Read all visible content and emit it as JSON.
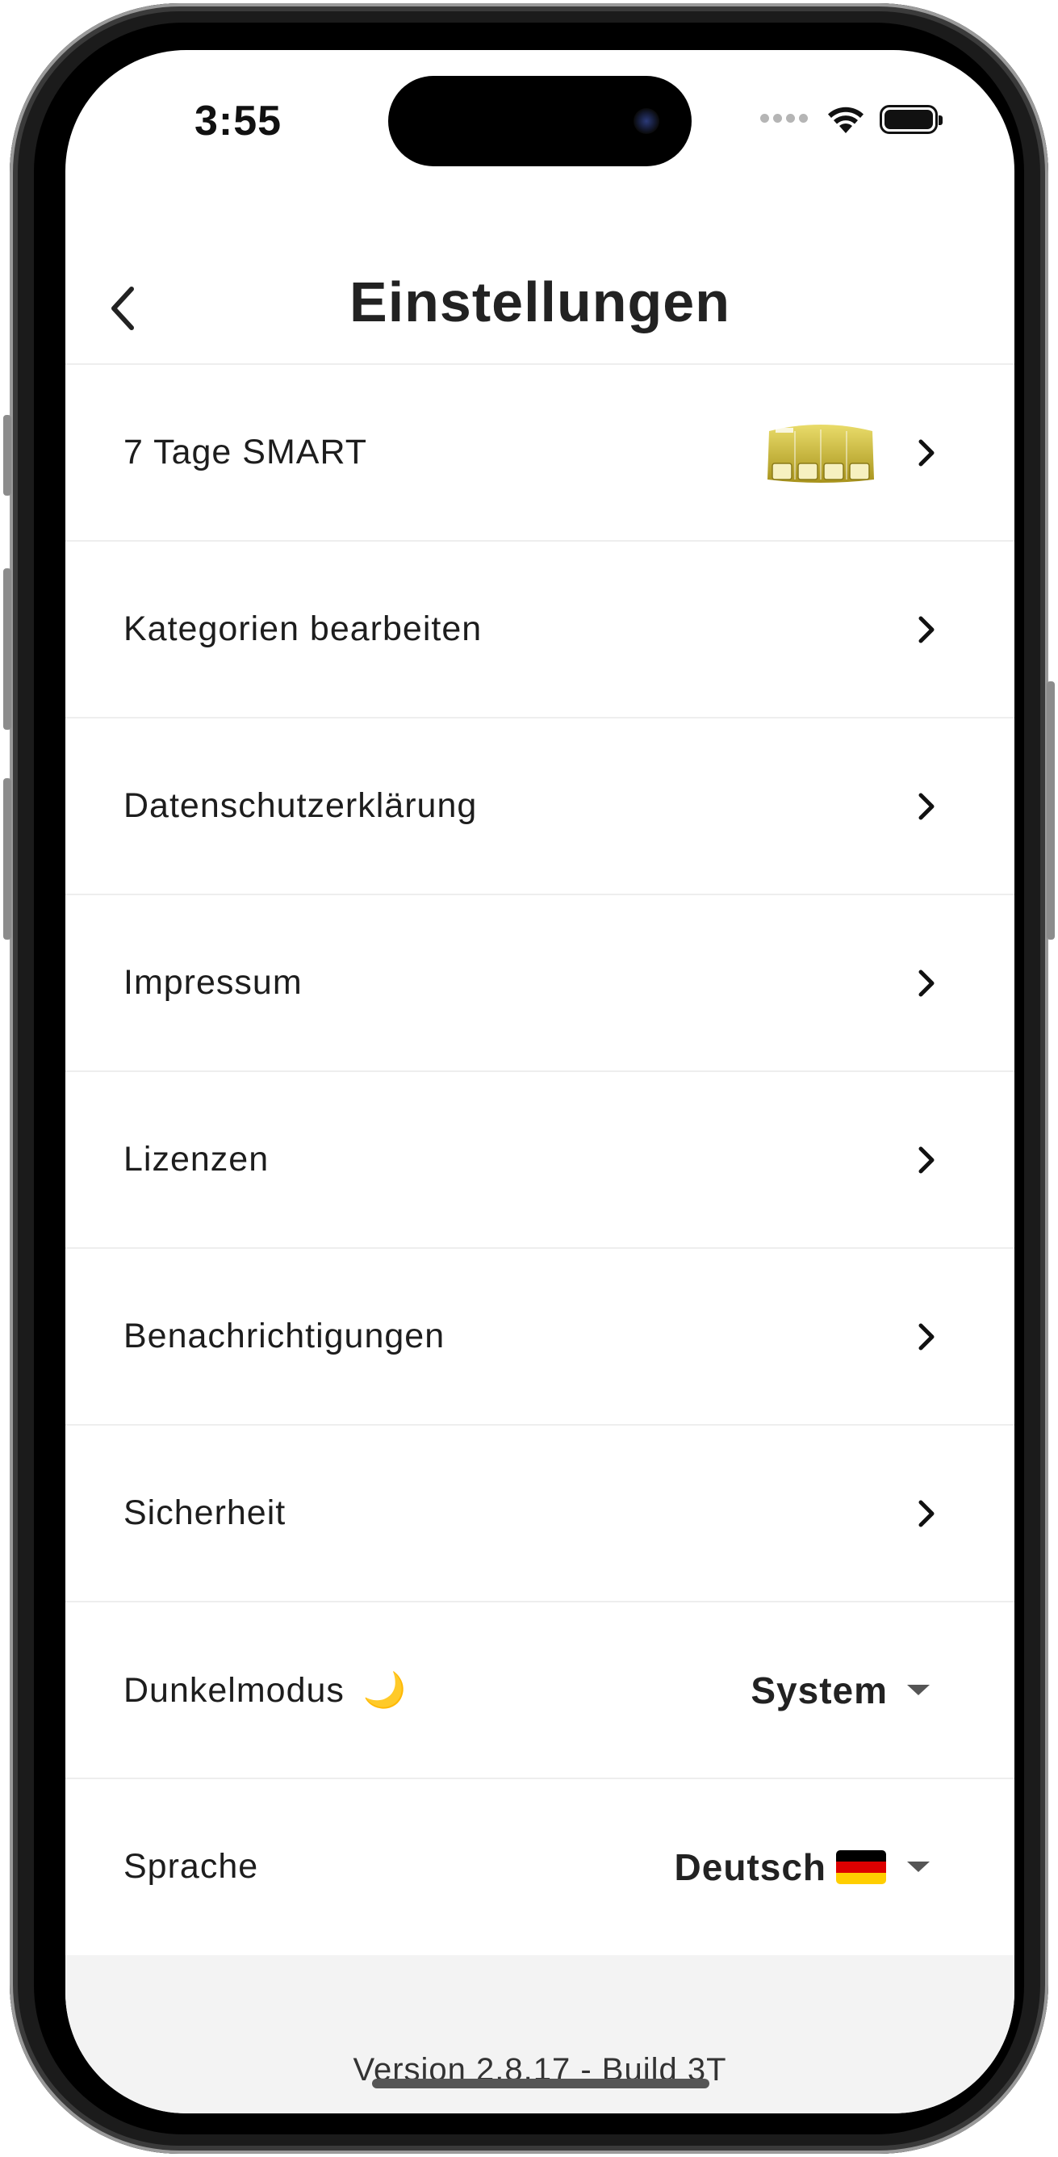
{
  "status_bar": {
    "time": "3:55"
  },
  "header": {
    "title": "Einstellungen",
    "back_icon": "chevron-left-icon"
  },
  "rows": [
    {
      "label": "7 Tage SMART",
      "has_image": true
    },
    {
      "label": "Kategorien bearbeiten"
    },
    {
      "label": "Datenschutzerklärung"
    },
    {
      "label": "Impressum"
    },
    {
      "label": "Lizenzen"
    },
    {
      "label": "Benachrichtigungen"
    },
    {
      "label": "Sicherheit"
    }
  ],
  "dark_mode": {
    "label": "Dunkelmodus",
    "emoji": "🌙",
    "value": "System"
  },
  "language": {
    "label": "Sprache",
    "value": "Deutsch"
  },
  "footer": {
    "version": "Version 2.8.17 - Build 3T"
  },
  "colors": {
    "accent_gold": "#c9b33a",
    "flag_black": "#000000",
    "flag_red": "#dd0000",
    "flag_gold": "#ffce00"
  }
}
